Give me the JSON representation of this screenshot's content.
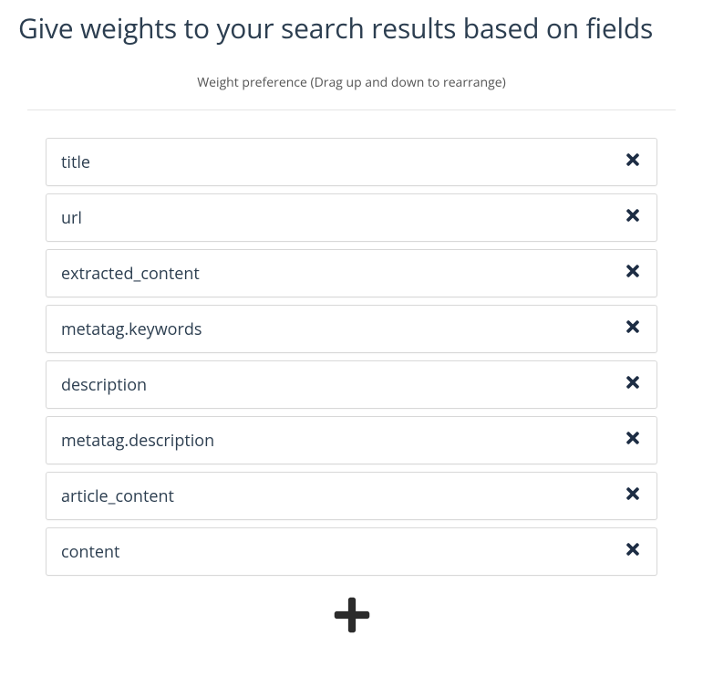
{
  "title": "Give weights to your search results based on fields",
  "subtitle": "Weight preference (Drag up and down to rearrange)",
  "fields": [
    {
      "label": "title"
    },
    {
      "label": "url"
    },
    {
      "label": "extracted_content"
    },
    {
      "label": "metatag.keywords"
    },
    {
      "label": "description"
    },
    {
      "label": "metatag.description"
    },
    {
      "label": "article_content"
    },
    {
      "label": "content"
    }
  ]
}
